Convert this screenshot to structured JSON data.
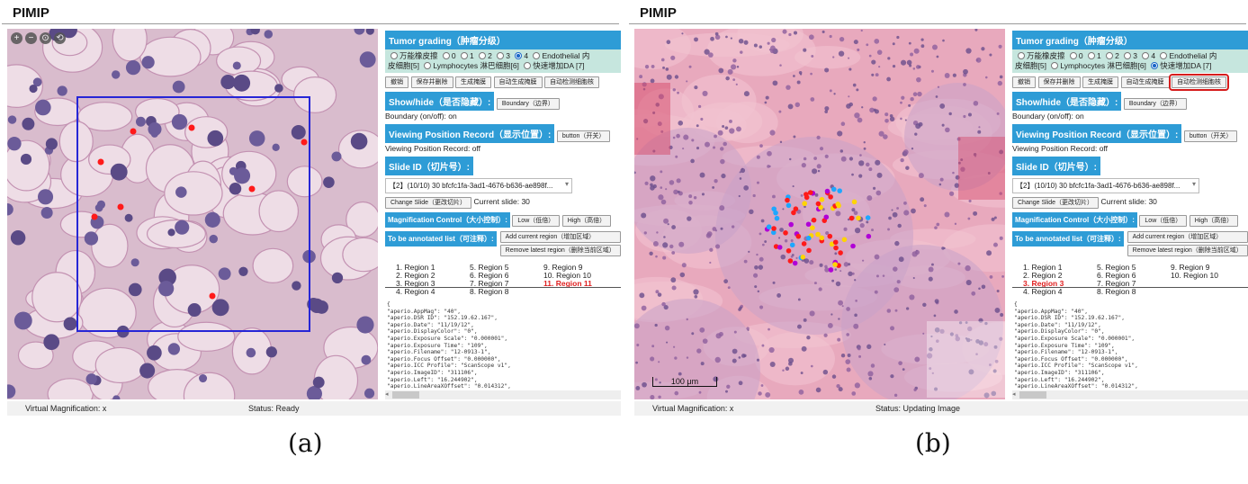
{
  "app_title": "PIMIP",
  "zoom_icons": [
    "+",
    "−",
    "⊙",
    "⟲"
  ],
  "captions": [
    "(a)",
    "(b)"
  ],
  "panel_a": {
    "tumor_grading": {
      "title": "Tumor grading（肿瘤分级）",
      "line1": {
        "opt0": "万能橡皮擦",
        "opt1": "0",
        "opt2": "1",
        "opt3": "2",
        "opt4": "3",
        "opt5": "4",
        "opt6": "Endothelial 内"
      },
      "line2": {
        "pre": "皮细胞[5]",
        "opt7": "Lymphocytes 淋巴细胞[6]",
        "opt8": "快速增加DA [7]"
      },
      "selected": "4"
    },
    "actions": [
      "撤销",
      "保存并删除",
      "生成掩膜",
      "自动生成掩膜",
      "自动检测细胞核"
    ],
    "show_hide": {
      "title": "Show/hide（是否隐藏）:",
      "button": "Boundary（边界）",
      "status": "Boundary (on/off): on"
    },
    "viewing": {
      "title": "Viewing Position Record（显示位置）:",
      "button": "button（开关）",
      "status": "Viewing Position Record: off"
    },
    "slide_id": {
      "title": "Slide ID（切片号）:",
      "select_value": "【2】(10/10) 30 bfcfc1fa-3ad1-4676-b636-ae898f...",
      "change_button": "Change Slide（更改切片）",
      "current": "Current slide: 30"
    },
    "magnification": {
      "title": "Magnification Control（大小控制）:",
      "low": "Low（低倍）",
      "high": "High（高倍）"
    },
    "annotate": {
      "title": "To be annotated list（可注释）:",
      "add": "Add current region（增加区域）",
      "remove": "Remove latest region（删除当前区域）"
    },
    "regions": [
      "1. Region 1",
      "2. Region 2",
      "3. Region 3",
      "4. Region 4",
      "5. Region 5",
      "6. Region 6",
      "7. Region 7",
      "8. Region 8",
      "9. Region 9",
      "10. Region 10",
      "11.  Region 11"
    ],
    "highlighted_region": "11.  Region 11",
    "metadata": [
      "{",
      "\"aperio.AppMag\": \"40\",",
      "\"aperio.DSR ID\": \"152.19.62.167\",",
      "\"aperio.Date\": \"11/19/12\",",
      "\"aperio.DisplayColor\": \"0\",",
      "\"aperio.Exposure Scale\": \"0.000001\",",
      "\"aperio.Exposure Time\": \"109\",",
      "\"aperio.Filename\": \"12-0913-1\",",
      "\"aperio.Focus Offset\": \"0.000000\",",
      "\"aperio.ICC Profile\": \"ScanScope v1\",",
      "\"aperio.ImageID\": \"311106\",",
      "\"aperio.Left\": \"16.244902\",",
      "\"aperio.LineAreaXOffset\": \"0.014312\","
    ],
    "status": {
      "magnification": "Virtual Magnification: x",
      "status": "Status: Ready"
    }
  },
  "panel_b": {
    "tumor_grading": {
      "title": "Tumor grading（肿瘤分级）",
      "line1": {
        "opt0": "万能橡皮擦",
        "opt1": "0",
        "opt2": "1",
        "opt3": "2",
        "opt4": "3",
        "opt5": "4",
        "opt6": "Endothelial 内"
      },
      "line2": {
        "pre": "皮细胞[5]",
        "opt7": "Lymphocytes 淋巴细胞[6]",
        "opt8": "快速增加DA [7]"
      },
      "selected": "快速增加DA [7]"
    },
    "actions": [
      "撤销",
      "保存并删除",
      "生成掩膜",
      "自动生成掩膜",
      "自动检测细胞核"
    ],
    "show_hide": {
      "title": "Show/hide（是否隐藏）:",
      "button": "Boundary（边界）",
      "status": "Boundary (on/off): on"
    },
    "viewing": {
      "title": "Viewing Position Record（显示位置）:",
      "button": "button（开关）",
      "status": "Viewing Position Record: off"
    },
    "slide_id": {
      "title": "Slide ID（切片号）:",
      "select_value": "【2】(10/10) 30 bfcfc1fa-3ad1-4676-b636-ae898f...",
      "change_button": "Change Slide（更改切片）",
      "current": "Current slide: 30"
    },
    "magnification": {
      "title": "Magnification Control（大小控制）:",
      "low": "Low（低倍）",
      "high": "High（高倍）"
    },
    "annotate": {
      "title": "To be annotated list（可注释）:",
      "add": "Add current region（增加区域）",
      "remove": "Remove latest region（删除当前区域）"
    },
    "regions": [
      "1. Region 1",
      "2. Region 2",
      "3. Region 3",
      "4. Region 4",
      "5. Region 5",
      "6. Region 6",
      "7. Region 7",
      "8. Region 8",
      "9. Region 9",
      "10. Region 10"
    ],
    "highlighted_region": "3. Region 3",
    "scale_label": "100 μm",
    "metadata": [
      "{",
      "\"aperio.AppMag\": \"40\",",
      "\"aperio.DSR ID\": \"152.19.62.167\",",
      "\"aperio.Date\": \"11/19/12\",",
      "\"aperio.DisplayColor\": \"0\",",
      "\"aperio.Exposure Scale\": \"0.000001\",",
      "\"aperio.Exposure Time\": \"109\",",
      "\"aperio.Filename\": \"12-0913-1\",",
      "\"aperio.Focus Offset\": \"0.000000\",",
      "\"aperio.ICC Profile\": \"ScanScope v1\",",
      "\"aperio.ImageID\": \"311106\",",
      "\"aperio.Left\": \"16.244902\",",
      "\"aperio.LineAreaXOffset\": \"0.014312\","
    ],
    "status": {
      "magnification": "Virtual Magnification: x",
      "status": "Status: Updating Image"
    }
  },
  "colors": {
    "header_blue": "#2e9cd6",
    "grade_bg": "#c6e6de",
    "highlight_red": "#e02020",
    "roi_blue": "#2626d6"
  }
}
